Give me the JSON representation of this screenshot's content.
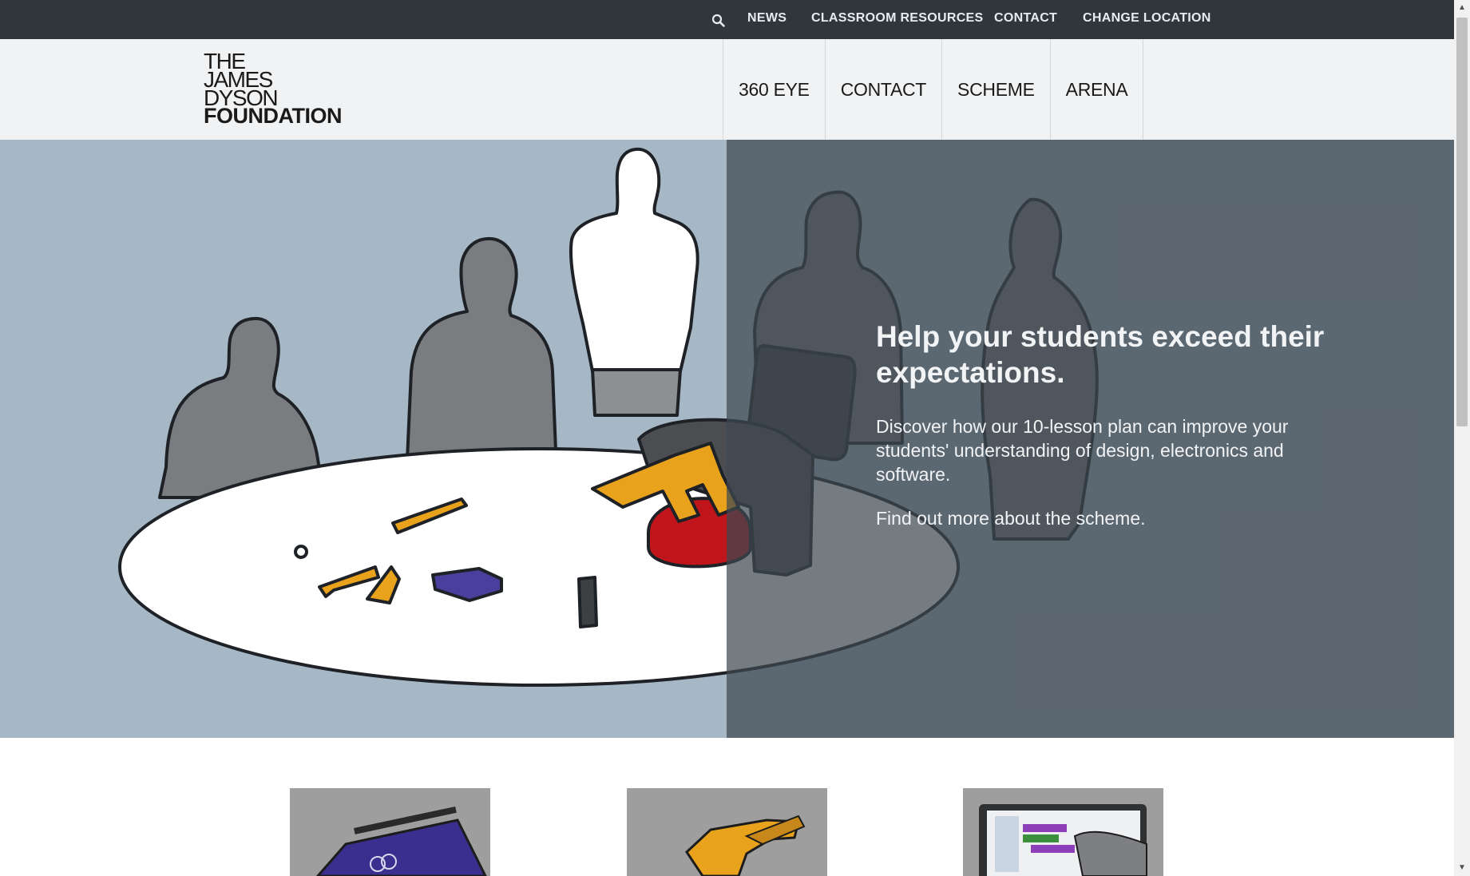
{
  "utility_nav": {
    "items": [
      "NEWS",
      "CLASSROOM RESOURCES",
      "CONTACT",
      "CHANGE LOCATION"
    ]
  },
  "logo": {
    "lines": [
      "THE",
      "JAMES",
      "DYSON",
      "FOUNDATION"
    ]
  },
  "main_nav": {
    "items": [
      "360 EYE",
      "CONTACT",
      "SCHEME",
      "ARENA"
    ]
  },
  "hero": {
    "heading": "Help your students exceed their expectations.",
    "body": "Discover how our 10-lesson plan can improve your students' understanding of design, electronics and software.",
    "link": "Find out more about the scheme."
  },
  "colors": {
    "topbar": "#2f363c",
    "nav_bg": "#f1f2f3",
    "hero_bg": "#a6b8c6",
    "hero_overlay": "#3f4850",
    "robot_red": "#c0151a",
    "part_orange": "#e8a21c",
    "box_purple": "#4b3f9e"
  },
  "icons": {
    "search": "search-icon"
  }
}
